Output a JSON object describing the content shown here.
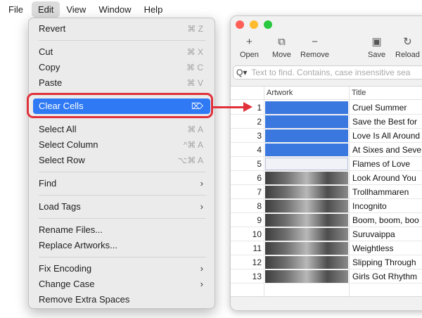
{
  "menubar": {
    "items": [
      "File",
      "Edit",
      "View",
      "Window",
      "Help"
    ],
    "active": "Edit"
  },
  "window": {
    "traffic_lights": [
      "#ff5f57",
      "#febc2e",
      "#28c840"
    ],
    "toolbar": {
      "open": "Open",
      "move": "Move",
      "remove": "Remove",
      "save": "Save",
      "reload": "Reload",
      "open_icon": "+",
      "move_icon": "⧉",
      "remove_icon": "−",
      "save_icon": "▣",
      "reload_icon": "↻"
    },
    "search": {
      "icon": "Q▾",
      "placeholder": "Text to find. Contains, case insensitive sea"
    },
    "columns": {
      "artwork": "Artwork",
      "title": "Title"
    },
    "rows": [
      {
        "n": "1",
        "title": "Cruel Summer",
        "art": "selected"
      },
      {
        "n": "2",
        "title": "Save the Best for",
        "art": "selected"
      },
      {
        "n": "3",
        "title": "Love Is All Around",
        "art": "selected"
      },
      {
        "n": "4",
        "title": "At Sixes and Seve",
        "art": "selected"
      },
      {
        "n": "5",
        "title": "Flames of Love",
        "art": "empty"
      },
      {
        "n": "6",
        "title": "Look Around You",
        "art": "image"
      },
      {
        "n": "7",
        "title": "Trollhammaren",
        "art": "image"
      },
      {
        "n": "8",
        "title": "Incognito",
        "art": "image"
      },
      {
        "n": "9",
        "title": "Boom, boom, boo",
        "art": "image"
      },
      {
        "n": "10",
        "title": "Suruvaippa",
        "art": "image"
      },
      {
        "n": "11",
        "title": "Weightless",
        "art": "image"
      },
      {
        "n": "12",
        "title": "Slipping Through",
        "art": "image"
      },
      {
        "n": "13",
        "title": "Girls Got Rhythm",
        "art": "image"
      }
    ],
    "selection_color": "#3a78e0"
  },
  "menu": {
    "revert": {
      "label": "Revert",
      "shortcut": "⌘ Z"
    },
    "cut": {
      "label": "Cut",
      "shortcut": "⌘ X"
    },
    "copy": {
      "label": "Copy",
      "shortcut": "⌘ C"
    },
    "paste": {
      "label": "Paste",
      "shortcut": "⌘ V"
    },
    "clear_cells": {
      "label": "Clear Cells",
      "shortcut": "⌦"
    },
    "select_all": {
      "label": "Select All",
      "shortcut": "⌘ A"
    },
    "select_column": {
      "label": "Select Column",
      "shortcut": "^⌘ A"
    },
    "select_row": {
      "label": "Select Row",
      "shortcut": "⌥⌘ A"
    },
    "find": {
      "label": "Find",
      "chevron": "›"
    },
    "load_tags": {
      "label": "Load Tags",
      "chevron": "›"
    },
    "rename_files": {
      "label": "Rename Files..."
    },
    "replace_artworks": {
      "label": "Replace Artworks..."
    },
    "fix_encoding": {
      "label": "Fix Encoding",
      "chevron": "›"
    },
    "change_case": {
      "label": "Change Case",
      "chevron": "›"
    },
    "remove_extra_spaces": {
      "label": "Remove Extra Spaces"
    },
    "highlight_color": "#2f7af4"
  },
  "annotation": {
    "color": "#e0313b"
  }
}
